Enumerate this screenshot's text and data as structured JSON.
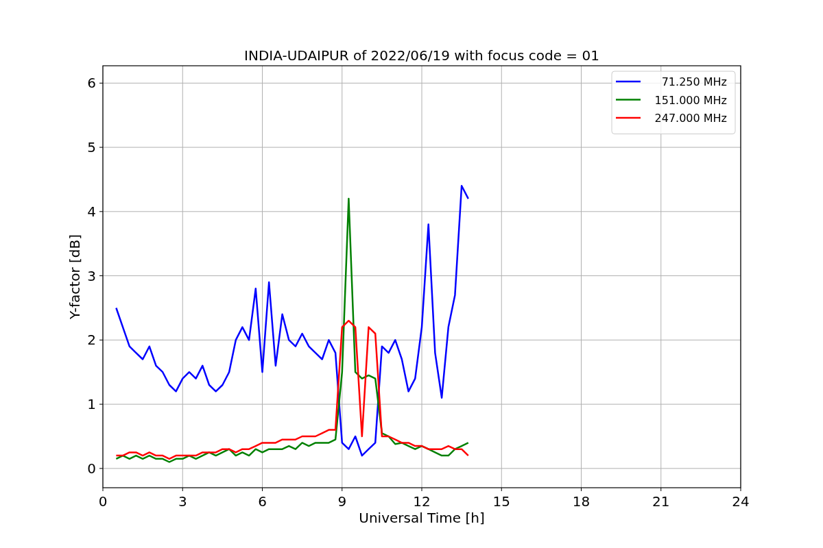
{
  "chart_data": {
    "type": "line",
    "title": "INDIA-UDAIPUR of 2022/06/19 with focus code = 01",
    "xlabel": "Universal Time [h]",
    "ylabel": "Y-factor [dB]",
    "x": [
      0.5,
      0.75,
      1.0,
      1.25,
      1.5,
      1.75,
      2.0,
      2.25,
      2.5,
      2.75,
      3.0,
      3.25,
      3.5,
      3.75,
      4.0,
      4.25,
      4.5,
      4.75,
      5.0,
      5.25,
      5.5,
      5.75,
      6.0,
      6.25,
      6.5,
      6.75,
      7.0,
      7.25,
      7.5,
      7.75,
      8.0,
      8.25,
      8.5,
      8.75,
      9.0,
      9.25,
      9.5,
      9.75,
      10.0,
      10.25,
      10.5,
      10.75,
      11.0,
      11.25,
      11.5,
      11.75,
      12.0,
      12.25,
      12.5,
      12.75,
      13.0,
      13.25,
      13.5,
      13.75
    ],
    "series": [
      {
        "name": "71.250 MHz",
        "color": "#0000ff",
        "values": [
          2.5,
          2.2,
          1.9,
          1.8,
          1.7,
          1.9,
          1.6,
          1.5,
          1.3,
          1.2,
          1.4,
          1.5,
          1.4,
          1.6,
          1.3,
          1.2,
          1.3,
          1.5,
          2.0,
          2.2,
          2.0,
          2.8,
          1.5,
          2.9,
          1.6,
          2.4,
          2.0,
          1.9,
          2.1,
          1.9,
          1.8,
          1.7,
          2.0,
          1.8,
          0.4,
          0.3,
          0.5,
          0.2,
          0.3,
          0.4,
          1.9,
          1.8,
          2.0,
          1.7,
          1.2,
          1.4,
          2.2,
          3.8,
          1.8,
          1.1,
          2.2,
          2.7,
          4.4,
          4.2
        ]
      },
      {
        "name": "151.000 MHz",
        "color": "#008000",
        "values": [
          0.15,
          0.2,
          0.15,
          0.2,
          0.15,
          0.2,
          0.15,
          0.15,
          0.1,
          0.15,
          0.15,
          0.2,
          0.15,
          0.2,
          0.25,
          0.2,
          0.25,
          0.3,
          0.2,
          0.25,
          0.2,
          0.3,
          0.25,
          0.3,
          0.3,
          0.3,
          0.35,
          0.3,
          0.4,
          0.35,
          0.4,
          0.4,
          0.4,
          0.45,
          1.5,
          4.2,
          1.5,
          1.4,
          1.45,
          1.4,
          0.55,
          0.5,
          0.38,
          0.4,
          0.35,
          0.3,
          0.35,
          0.3,
          0.25,
          0.2,
          0.2,
          0.3,
          0.35,
          0.4
        ]
      },
      {
        "name": "247.000 MHz",
        "color": "#ff0000",
        "values": [
          0.2,
          0.2,
          0.25,
          0.25,
          0.2,
          0.25,
          0.2,
          0.2,
          0.15,
          0.2,
          0.2,
          0.2,
          0.2,
          0.25,
          0.25,
          0.25,
          0.3,
          0.3,
          0.25,
          0.3,
          0.3,
          0.35,
          0.4,
          0.4,
          0.4,
          0.45,
          0.45,
          0.45,
          0.5,
          0.5,
          0.5,
          0.55,
          0.6,
          0.6,
          2.2,
          2.3,
          2.2,
          0.5,
          2.2,
          2.1,
          0.5,
          0.5,
          0.45,
          0.4,
          0.4,
          0.35,
          0.35,
          0.3,
          0.3,
          0.3,
          0.35,
          0.3,
          0.3,
          0.2
        ]
      }
    ],
    "grid": true,
    "legend": true,
    "xlim": [
      0,
      24
    ],
    "ylim": [
      -0.3,
      6.27
    ],
    "xticks": [
      0,
      3,
      6,
      9,
      12,
      15,
      18,
      21,
      24
    ],
    "yticks": [
      0,
      1,
      2,
      3,
      4,
      5,
      6
    ]
  }
}
